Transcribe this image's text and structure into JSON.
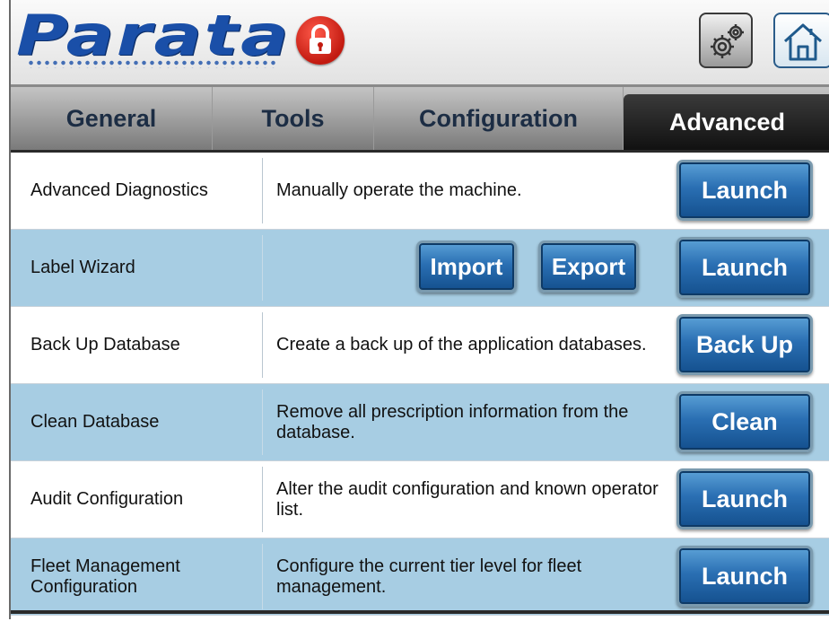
{
  "header": {
    "logo_text": "Parata",
    "icons": {
      "lock": "lock-icon",
      "settings": "gears-icon",
      "home": "home-icon"
    }
  },
  "tabs": [
    {
      "label": "General",
      "active": false
    },
    {
      "label": "Tools",
      "active": false
    },
    {
      "label": "Configuration",
      "active": false
    },
    {
      "label": "Advanced",
      "active": true
    }
  ],
  "rows": [
    {
      "name": "Advanced Diagnostics",
      "description": "Manually operate the machine.",
      "button": "Launch"
    },
    {
      "name": "Label Wizard",
      "description": "",
      "button": "Launch",
      "extra_buttons": [
        "Import",
        "Export"
      ]
    },
    {
      "name": "Back Up Database",
      "description": "Create a back up of the application databases.",
      "button": "Back Up"
    },
    {
      "name": "Clean Database",
      "description": "Remove all prescription information from the database.",
      "button": "Clean"
    },
    {
      "name": "Audit Configuration",
      "description": "Alter the audit configuration and known operator list.",
      "button": "Launch"
    },
    {
      "name": "Fleet Management Configuration",
      "description": "Configure the current tier level for fleet management.",
      "button": "Launch"
    }
  ],
  "colors": {
    "brand": "#1a4fa8",
    "row_alt": "#a7cde3",
    "button": "#2a6fb3",
    "tab_active": "#1a1a1a"
  }
}
